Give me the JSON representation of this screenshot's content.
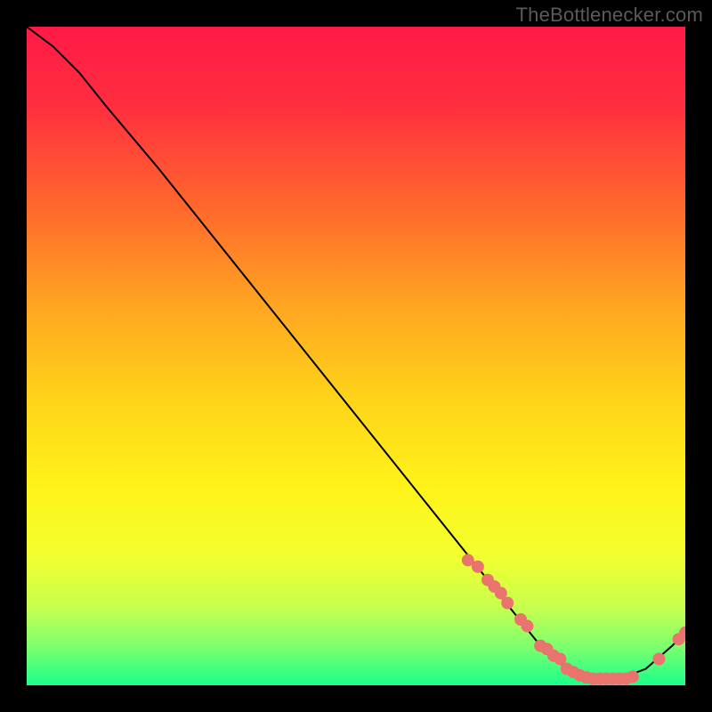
{
  "attribution": "TheBottlenecker.com",
  "chart_data": {
    "type": "line",
    "title": "",
    "xlabel": "",
    "ylabel": "",
    "xlim": [
      0,
      100
    ],
    "ylim": [
      0,
      100
    ],
    "x": [
      0,
      4,
      8,
      12,
      20,
      30,
      40,
      50,
      60,
      66,
      70,
      74,
      78,
      82,
      86,
      90,
      94,
      98,
      100
    ],
    "y": [
      100,
      97,
      93,
      88,
      78.5,
      66,
      53.5,
      41,
      28.5,
      21,
      16,
      11,
      6,
      2.5,
      1,
      1,
      2.5,
      6,
      8
    ],
    "markers_x": [
      67,
      68.5,
      70,
      71,
      72,
      73,
      75,
      76,
      78,
      79,
      80,
      81,
      82,
      83,
      84,
      85,
      86,
      87,
      88,
      89,
      90,
      91,
      92,
      96,
      99,
      100
    ],
    "markers_y": [
      19,
      18,
      16,
      15,
      14,
      12.5,
      10,
      9,
      6,
      5.5,
      4.5,
      4,
      2.5,
      2,
      1.5,
      1.2,
      1,
      1,
      1,
      1,
      1,
      1,
      1.3,
      4,
      7,
      8
    ]
  },
  "colors": {
    "gradient_stops": [
      {
        "offset": 0.0,
        "color": "#ff1a46"
      },
      {
        "offset": 0.12,
        "color": "#ff2e3f"
      },
      {
        "offset": 0.28,
        "color": "#ff6a2c"
      },
      {
        "offset": 0.42,
        "color": "#ffa421"
      },
      {
        "offset": 0.56,
        "color": "#ffd21a"
      },
      {
        "offset": 0.7,
        "color": "#fff31a"
      },
      {
        "offset": 0.8,
        "color": "#f3ff2e"
      },
      {
        "offset": 0.88,
        "color": "#c9ff4d"
      },
      {
        "offset": 0.94,
        "color": "#7fff6e"
      },
      {
        "offset": 1.0,
        "color": "#1aff8a"
      }
    ],
    "line": "#000000",
    "marker_fill": "#e9746d",
    "marker_stroke": "#d85f59"
  }
}
